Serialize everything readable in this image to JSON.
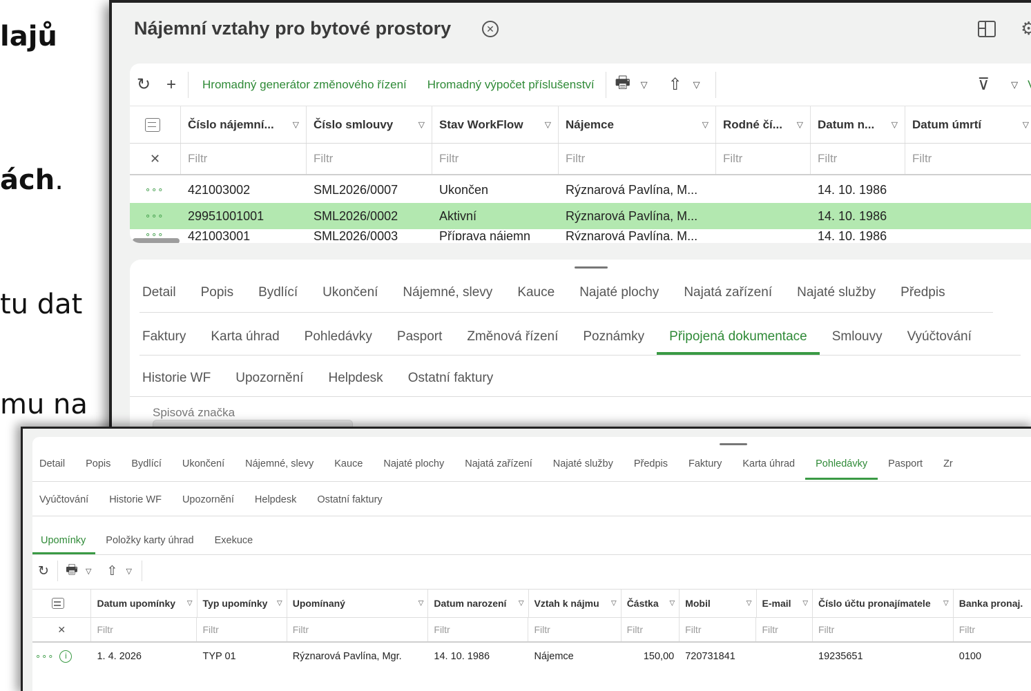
{
  "background_slide": {
    "line1": "lajů",
    "line2": "ách",
    "line2_period": ".",
    "line3": "tu dat",
    "line4": "mu na"
  },
  "window1": {
    "title": "Nájemní vztahy pro bytové prostory",
    "title_close_icon": "circle-x-icon",
    "toolbar": {
      "refresh_icon": "↻",
      "add_icon": "+",
      "generator_link": "Hromadný generátor změnového řízení",
      "calc_link": "Hromadný výpočet příslušenství",
      "print_icon": "printer-icon",
      "export_icon": "share-icon",
      "filter_icon": "funnel-icon",
      "right_label": "Vš"
    },
    "columns": [
      "Číslo nájemní...",
      "Číslo smlouvy",
      "Stav WorkFlow",
      "Nájemce",
      "Rodné čí...",
      "Datum n...",
      "Datum úmrtí"
    ],
    "filter_placeholder": "Filtr",
    "rows": [
      {
        "dots": "∘∘∘",
        "cislo": "421003002",
        "smlouva": "SML2026/0007",
        "stav": "Ukončen",
        "najemce": "Rýznarová Pavlína, M...",
        "rodne": "",
        "datum": "14. 10. 1986",
        "umrti": ""
      },
      {
        "dots": "∘∘∘",
        "cislo": "29951001001",
        "smlouva": "SML2026/0002",
        "stav": "Aktivní",
        "najemce": "Rýznarová Pavlína, M...",
        "rodne": "",
        "datum": "14. 10. 1986",
        "umrti": ""
      },
      {
        "dots": "∘∘∘",
        "cislo": "421003001",
        "smlouva": "SML2026/0003",
        "stav": "Příprava nájemn",
        "najemce": "Rýznarová Pavlína, M...",
        "rodne": "",
        "datum": "14. 10. 1986",
        "umrti": ""
      }
    ],
    "tabs_row1": [
      "Detail",
      "Popis",
      "Bydlící",
      "Ukončení",
      "Nájemné, slevy",
      "Kauce",
      "Najaté plochy",
      "Najatá zařízení",
      "Najaté služby",
      "Předpis"
    ],
    "tabs_row2": [
      "Faktury",
      "Karta úhrad",
      "Pohledávky",
      "Pasport",
      "Změnová řízení",
      "Poznámky",
      "Připojená dokumentace",
      "Smlouvy",
      "Vyúčtování"
    ],
    "tabs_row3": [
      "Historie WF",
      "Upozornění",
      "Helpdesk",
      "Ostatní faktury"
    ],
    "active_tab": "Připojená dokumentace",
    "field_label": "Spisová značka",
    "accent_color": "#3a9a44",
    "selected_row_color": "#b3e8b0"
  },
  "window2": {
    "tabs_row1": [
      "Detail",
      "Popis",
      "Bydlící",
      "Ukončení",
      "Nájemné, slevy",
      "Kauce",
      "Najaté plochy",
      "Najatá zařízení",
      "Najaté služby",
      "Předpis",
      "Faktury",
      "Karta úhrad",
      "Pohledávky",
      "Pasport",
      "Zr"
    ],
    "tabs_row2": [
      "Vyúčtování",
      "Historie WF",
      "Upozornění",
      "Helpdesk",
      "Ostatní faktury"
    ],
    "active_tab": "Pohledávky",
    "subtabs": [
      "Upomínky",
      "Položky karty úhrad",
      "Exekuce"
    ],
    "active_subtab": "Upomínky",
    "columns": [
      "Datum upomínky",
      "Typ upomínky",
      "Upomínaný",
      "Datum narození",
      "Vztah k nájmu",
      "Částka",
      "Mobil",
      "E-mail",
      "Číslo účtu pronajímatele",
      "Banka pronaj."
    ],
    "filter_placeholder": "Filtr",
    "row": {
      "dots": "∘∘∘",
      "info_icon": "i",
      "datum": "1. 4. 2026",
      "typ": "TYP 01",
      "upominany": "Rýznarová Pavlína, Mgr.",
      "narozeni": "14. 10. 1986",
      "vztah": "Nájemce",
      "castka": "150,00",
      "mobil": "720731841",
      "email": "",
      "ucet": "19235651",
      "banka": "0100"
    }
  }
}
